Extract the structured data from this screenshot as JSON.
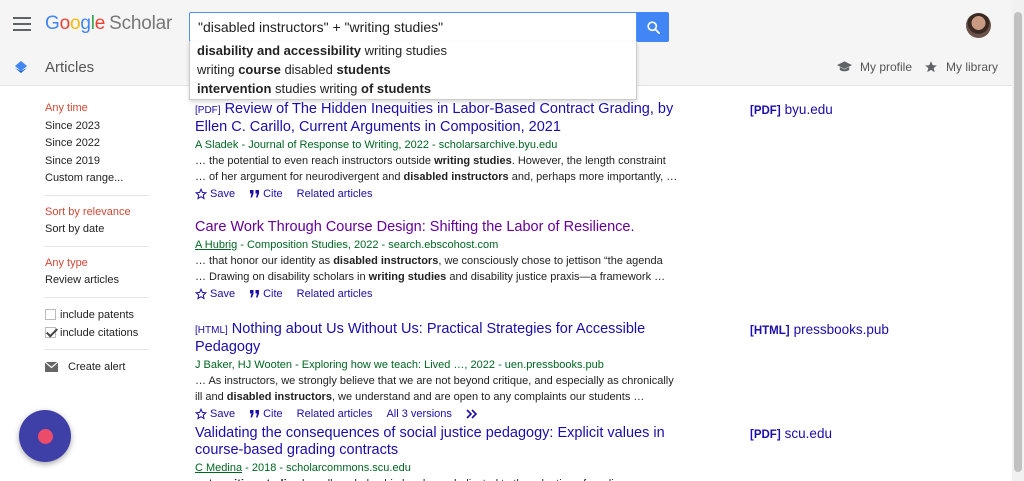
{
  "header": {
    "logo": {
      "g1": "G",
      "g2": "o",
      "g3": "o",
      "g4": "g",
      "g5": "l",
      "g6": "e",
      "suffix": "Scholar"
    },
    "search": {
      "value": "\"disabled instructors\" + \"writing studies\""
    },
    "suggestions": [
      {
        "parts": [
          [
            "b",
            "disability and accessibility"
          ],
          [
            "n",
            " writing studies"
          ]
        ]
      },
      {
        "parts": [
          [
            "n",
            "writing "
          ],
          [
            "b",
            "course"
          ],
          [
            "n",
            " disabled "
          ],
          [
            "b",
            "students"
          ]
        ]
      },
      {
        "parts": [
          [
            "b",
            "intervention"
          ],
          [
            "n",
            " studies writing "
          ],
          [
            "b",
            "of students"
          ]
        ]
      }
    ],
    "section_label": "Articles",
    "my_profile": "My profile",
    "my_library": "My library"
  },
  "sidebar": {
    "time": [
      "Any time",
      "Since 2023",
      "Since 2022",
      "Since 2019",
      "Custom range..."
    ],
    "sort": [
      "Sort by relevance",
      "Sort by date"
    ],
    "type": [
      "Any type",
      "Review articles"
    ],
    "include_patents": "include patents",
    "include_citations": "include citations",
    "create_alert": "Create alert"
  },
  "actions": {
    "save": "Save",
    "cite": "Cite",
    "related": "Related articles"
  },
  "results": [
    {
      "tag": "[PDF]",
      "title": "Review of The Hidden Inequities in Labor-Based Contract Grading, by Ellen C. Carillo, Current Arguments in Composition, 2021",
      "visited": false,
      "author": "",
      "meta": "A Sladek - Journal of Response to Writing, 2022 - scholarsarchive.byu.edu",
      "snippet1": [
        [
          "n",
          "… the potential to even reach instructors outside "
        ],
        [
          "b",
          "writing studies"
        ],
        [
          "n",
          ". However, the length constraint"
        ]
      ],
      "snippet2": [
        [
          "n",
          "… of her argument for neurodivergent and "
        ],
        [
          "b",
          "disabled instructors"
        ],
        [
          "n",
          " and, perhaps more importantly, …"
        ]
      ],
      "versions": "",
      "side_tag": "[PDF]",
      "side_domain": "byu.edu"
    },
    {
      "tag": "",
      "title": "Care Work Through Course Design: Shifting the Labor of Resilience.",
      "visited": true,
      "author": "A Hubrig",
      "meta": " - Composition Studies, 2022 - search.ebscohost.com",
      "snippet1": [
        [
          "n",
          "… that honor our identity as "
        ],
        [
          "b",
          "disabled instructors"
        ],
        [
          "n",
          ", we consciously chose to jettison “the agenda"
        ]
      ],
      "snippet2": [
        [
          "n",
          "… Drawing on disability scholars in "
        ],
        [
          "b",
          "writing studies"
        ],
        [
          "n",
          " and disability justice praxis—a framework …"
        ]
      ],
      "versions": "",
      "side_tag": "",
      "side_domain": ""
    },
    {
      "tag": "[HTML]",
      "title": "Nothing about Us Without Us: Practical Strategies for Accessible Pedagogy",
      "visited": false,
      "author": "",
      "meta": "J Baker, HJ Wooten - Exploring how we teach: Lived …, 2022 - uen.pressbooks.pub",
      "snippet1": [
        [
          "n",
          "… As instructors, we strongly believe that we are not beyond critique, and especially as chronically"
        ]
      ],
      "snippet2": [
        [
          "n",
          "ill and "
        ],
        [
          "b",
          "disabled instructors"
        ],
        [
          "n",
          ", we understand and are open to any complaints our students …"
        ]
      ],
      "versions": "All 3 versions",
      "side_tag": "[HTML]",
      "side_domain": "pressbooks.pub"
    },
    {
      "tag": "",
      "title": "Validating the consequences of social justice pedagogy: Explicit values in course-based grading contracts",
      "visited": false,
      "author": "C Medina",
      "meta": " - 2018 - scholarcommons.scu.edu",
      "snippet1": [
        [
          "n",
          "… In "
        ],
        [
          "b",
          "writing studies"
        ],
        [
          "n",
          " broadly, scholarship has been dedicated to the adoption of grading"
        ]
      ],
      "snippet2": [],
      "versions": "",
      "side_tag": "[PDF]",
      "side_domain": "scu.edu"
    }
  ]
}
